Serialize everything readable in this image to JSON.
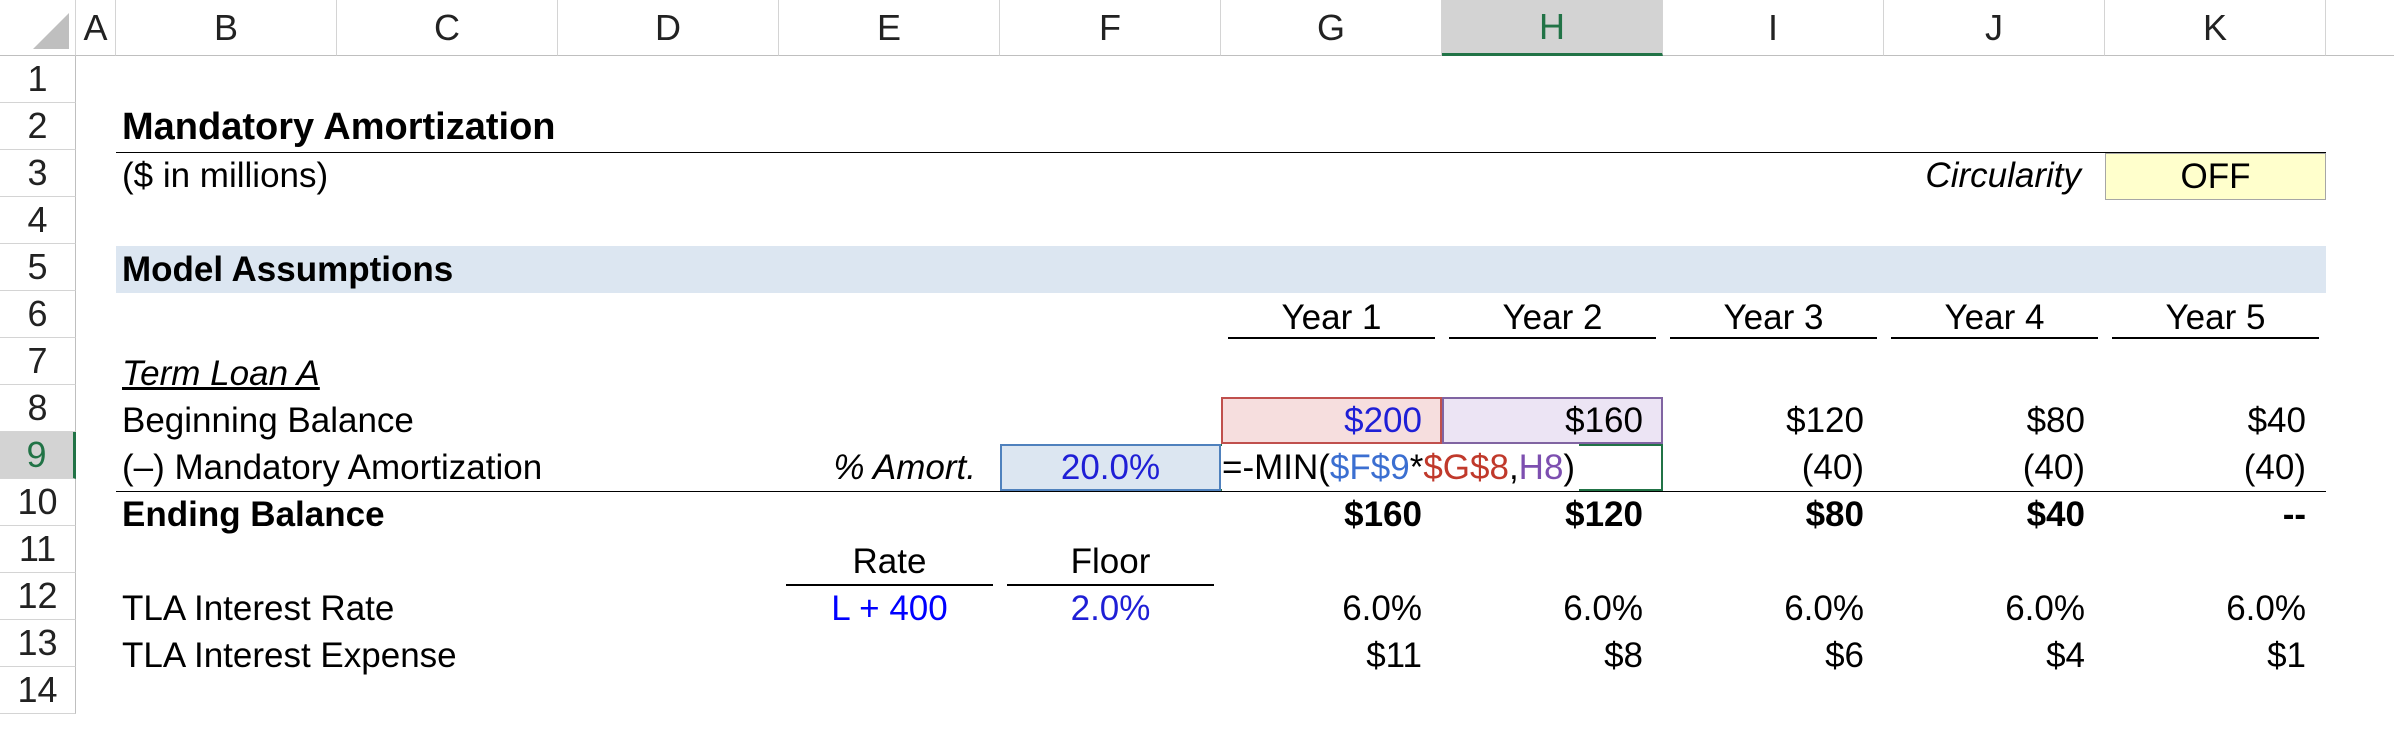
{
  "columns": [
    "A",
    "B",
    "C",
    "D",
    "E",
    "F",
    "G",
    "H",
    "I",
    "J",
    "K"
  ],
  "rows": [
    "1",
    "2",
    "3",
    "4",
    "5",
    "6",
    "7",
    "8",
    "9",
    "10",
    "11",
    "12",
    "13",
    "14"
  ],
  "selected_column": "H",
  "selected_row": "9",
  "title": "Mandatory Amortization",
  "subtitle": "($ in millions)",
  "circularity": {
    "label": "Circularity",
    "value": "OFF"
  },
  "section_header": "Model Assumptions",
  "years": [
    "Year 1",
    "Year 2",
    "Year 3",
    "Year 4",
    "Year 5"
  ],
  "loan_label": "Term Loan A",
  "beginning_balance": {
    "label": "Beginning Balance",
    "values": [
      "$200",
      "$160",
      "$120",
      "$80",
      "$40"
    ]
  },
  "amortization": {
    "label": "(–) Mandatory Amortization",
    "pct_label": "% Amort.",
    "pct_value": "20.0%",
    "formula_parts": [
      "=-MIN(",
      "$F$9",
      "*",
      "$G$8",
      ",",
      "H8",
      ")"
    ],
    "values": [
      "(40)",
      "(40)",
      "(40)"
    ]
  },
  "ending_balance": {
    "label": "Ending Balance",
    "values": [
      "$160",
      "$120",
      "$80",
      "$40",
      "--"
    ]
  },
  "rate_header": "Rate",
  "floor_header": "Floor",
  "interest_rate": {
    "label": "TLA Interest Rate",
    "rate": "L + 400",
    "floor": "2.0%",
    "values": [
      "6.0%",
      "6.0%",
      "6.0%",
      "6.0%",
      "6.0%"
    ]
  },
  "interest_expense": {
    "label": "TLA Interest Expense",
    "values": [
      "$11",
      "$8",
      "$6",
      "$4",
      "$1"
    ]
  },
  "colors": {
    "section_fill": "#dce6f1",
    "circularity_fill": "#ffffcc",
    "input_blue": "#0000ff",
    "selection_green": "#217346"
  }
}
